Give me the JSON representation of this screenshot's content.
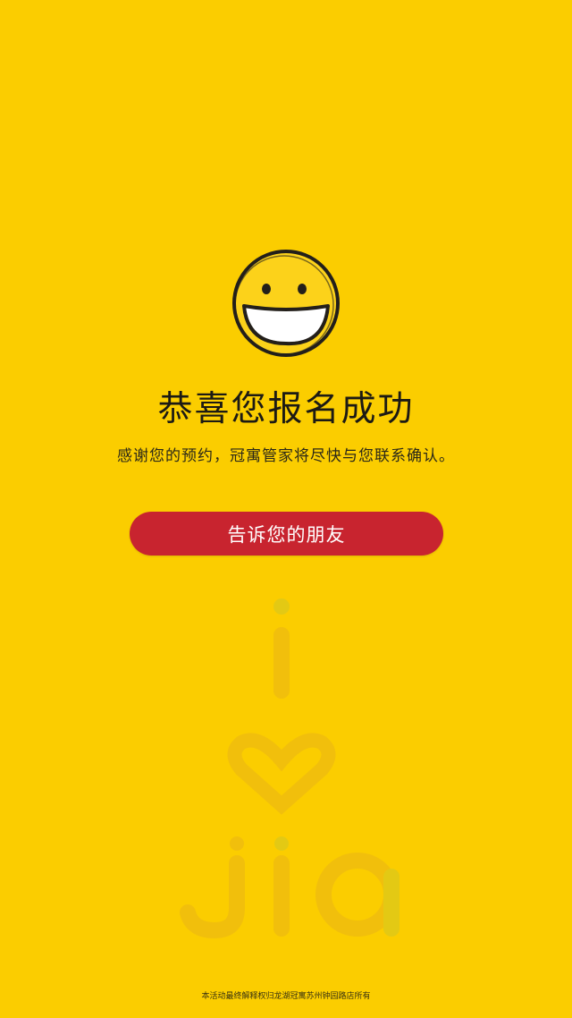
{
  "page": {
    "background_color": "#fbcd00"
  },
  "success": {
    "icon": "smiley-face-icon",
    "title": "恭喜您报名成功",
    "message": "感谢您的预约，冠寓管家将尽快与您联系确认。"
  },
  "share_button": {
    "label": "告诉您的朋友",
    "color": "#c8242f"
  },
  "watermark": {
    "icon": "i-love-jia-watermark-logo"
  },
  "footer": {
    "text": "本活动最终解释权归龙湖冠寓苏州钟园路店所有"
  }
}
